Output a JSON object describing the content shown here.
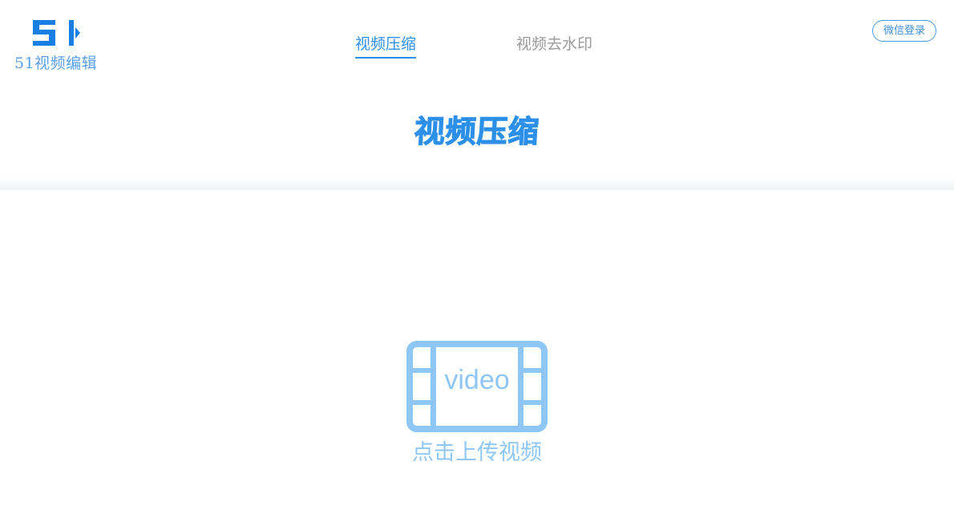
{
  "header": {
    "logo_text": "51视频编辑",
    "nav_tabs": [
      {
        "label": "视频压缩",
        "active": true
      },
      {
        "label": "视频去水印",
        "active": false
      }
    ],
    "login_label": "微信登录"
  },
  "page_title": "视频压缩",
  "upload": {
    "icon": "film-video-icon",
    "icon_label": "video",
    "text": "点击上传视频"
  },
  "colors": {
    "accent": "#2f8ee6",
    "light_blue": "#8ec7f6",
    "tab_inactive": "#999999"
  }
}
